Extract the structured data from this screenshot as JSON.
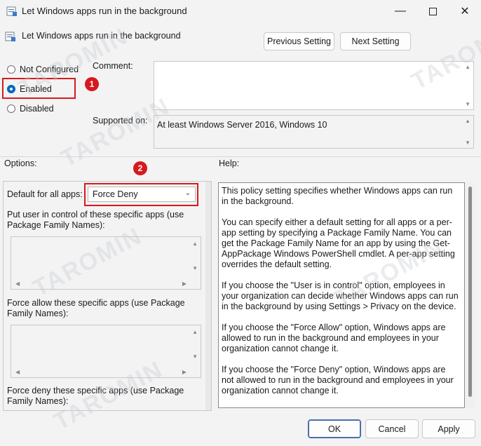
{
  "window": {
    "title": "Let Windows apps run in the background",
    "minimize_icon": "minimize-icon",
    "maximize_icon": "maximize-icon",
    "close_icon": "close-icon"
  },
  "header": {
    "policy_name": "Let Windows apps run in the background",
    "previous_setting": "Previous Setting",
    "next_setting": "Next Setting"
  },
  "state": {
    "options": [
      {
        "label": "Not Configured",
        "selected": false
      },
      {
        "label": "Enabled",
        "selected": true
      },
      {
        "label": "Disabled",
        "selected": false
      }
    ]
  },
  "comment": {
    "label": "Comment:",
    "value": ""
  },
  "supported": {
    "label": "Supported on:",
    "value": "At least Windows Server 2016, Windows 10"
  },
  "annotations": {
    "badge1": "1",
    "badge2": "2",
    "accent": "#d71920"
  },
  "options_panel": {
    "title": "Options:",
    "default_label": "Default for all apps:",
    "default_value": "Force Deny",
    "user_control_label": "Put user in control of these specific apps (use Package Family Names):",
    "force_allow_label": "Force allow these specific apps (use Package Family Names):",
    "force_deny_label": "Force deny these specific apps (use Package Family Names):"
  },
  "help_panel": {
    "title": "Help:",
    "paragraphs": [
      "This policy setting specifies whether Windows apps can run in the background.",
      "You can specify either a default setting for all apps or a per-app setting by specifying a Package Family Name. You can get the Package Family Name for an app by using the Get-AppPackage Windows PowerShell cmdlet. A per-app setting overrides the default setting.",
      "If you choose the \"User is in control\" option, employees in your organization can decide whether Windows apps can run in the background by using Settings > Privacy on the device.",
      "If you choose the \"Force Allow\" option, Windows apps are allowed to run in the background and employees in your organization cannot change it.",
      "If you choose the \"Force Deny\" option, Windows apps are not allowed to run in the background and employees in your organization cannot change it."
    ]
  },
  "footer": {
    "ok": "OK",
    "cancel": "Cancel",
    "apply": "Apply"
  },
  "watermark": "TAROMIN"
}
